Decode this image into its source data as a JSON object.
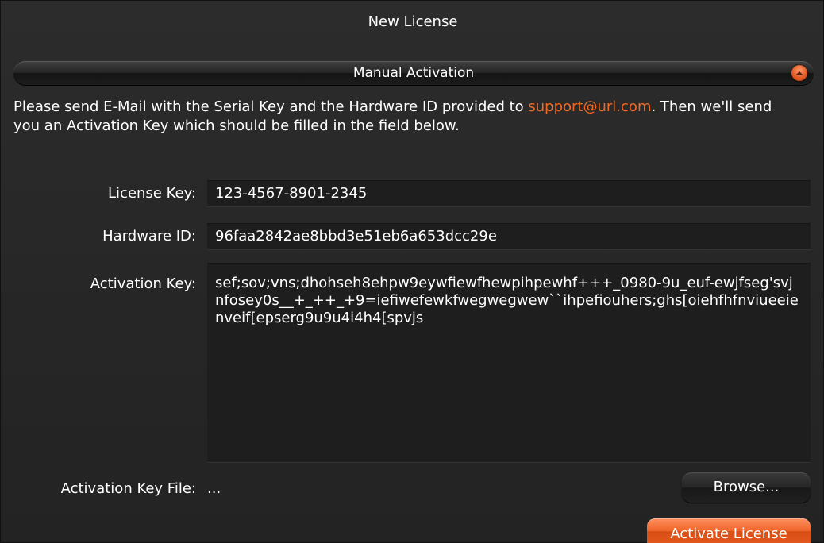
{
  "window": {
    "title": "New License"
  },
  "section": {
    "title": "Manual Activation",
    "collapse_icon": "chevron-up-icon",
    "accent_color": "#f06a24"
  },
  "description": {
    "text_before": "Please send E-Mail with the Serial Key and the Hardware ID provided to ",
    "email": "support@url.com",
    "text_after": ". Then we'll send you an Activation Key which should be filled in the field below."
  },
  "form": {
    "license_key": {
      "label": "License Key:",
      "value": "123-4567-8901-2345"
    },
    "hardware_id": {
      "label": "Hardware ID:",
      "value": "96faa2842ae8bbd3e51eb6a653dcc29e"
    },
    "activation_key": {
      "label": "Activation Key:",
      "value": "sef;sov;vns;dhohseh8ehpw9eywfiewfhewpihpewhf+++_0980-9u_euf-ewjfseg'svjnfosey0s__+_++_+9=iefiwefewkfwegwegwew``ihpefiouhers;ghs[oiehfhfnviueeienveif[epserg9u9u4i4h4[spvjs"
    },
    "activation_key_file": {
      "label": "Activation Key File:",
      "value": "..."
    }
  },
  "buttons": {
    "browse_label": "Browse...",
    "activate_label": "Activate License"
  }
}
